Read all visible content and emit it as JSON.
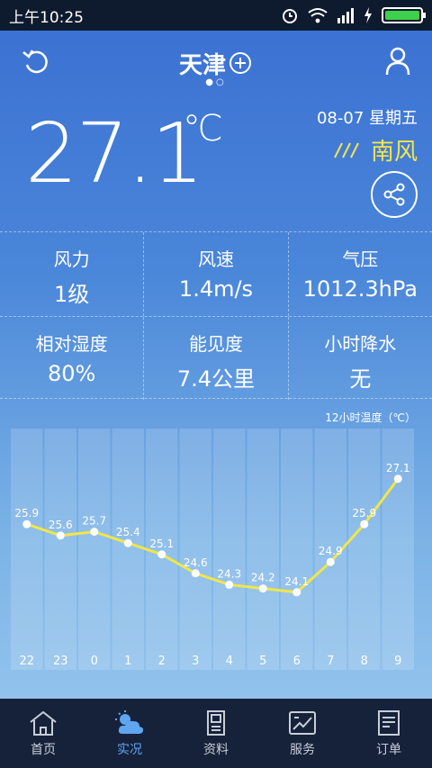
{
  "status": {
    "time": "上午10:25"
  },
  "header": {
    "city": "天津",
    "dots": "●○"
  },
  "current": {
    "temp": "27.1",
    "unit": "℃",
    "date": "08-07  星期五",
    "wind_direction": "南风"
  },
  "details": [
    {
      "label": "风力",
      "value": "1级"
    },
    {
      "label": "风速",
      "value": "1.4m/s"
    },
    {
      "label": "气压",
      "value": "1012.3hPa"
    },
    {
      "label": "相对湿度",
      "value": "80%"
    },
    {
      "label": "能见度",
      "value": "7.4公里"
    },
    {
      "label": "小时降水",
      "value": "无"
    }
  ],
  "chart_data": {
    "type": "line",
    "title": "12小时温度（℃）",
    "categories": [
      "22",
      "23",
      "0",
      "1",
      "2",
      "3",
      "4",
      "5",
      "6",
      "7",
      "8",
      "9"
    ],
    "values": [
      25.9,
      25.6,
      25.7,
      25.4,
      25.1,
      24.6,
      24.3,
      24.2,
      24.1,
      24.9,
      25.9,
      27.1
    ],
    "ylim": [
      23.0,
      28.0
    ],
    "line_color": "#f0e64a"
  },
  "tabs": [
    {
      "label": "首页",
      "icon": "home-icon"
    },
    {
      "label": "实况",
      "icon": "weather-icon"
    },
    {
      "label": "资料",
      "icon": "document-icon"
    },
    {
      "label": "服务",
      "icon": "service-icon"
    },
    {
      "label": "订单",
      "icon": "order-icon"
    }
  ],
  "colors": {
    "accent": "#5fa5f0",
    "wind": "#f4e64a",
    "tabbar": "#16213a"
  }
}
